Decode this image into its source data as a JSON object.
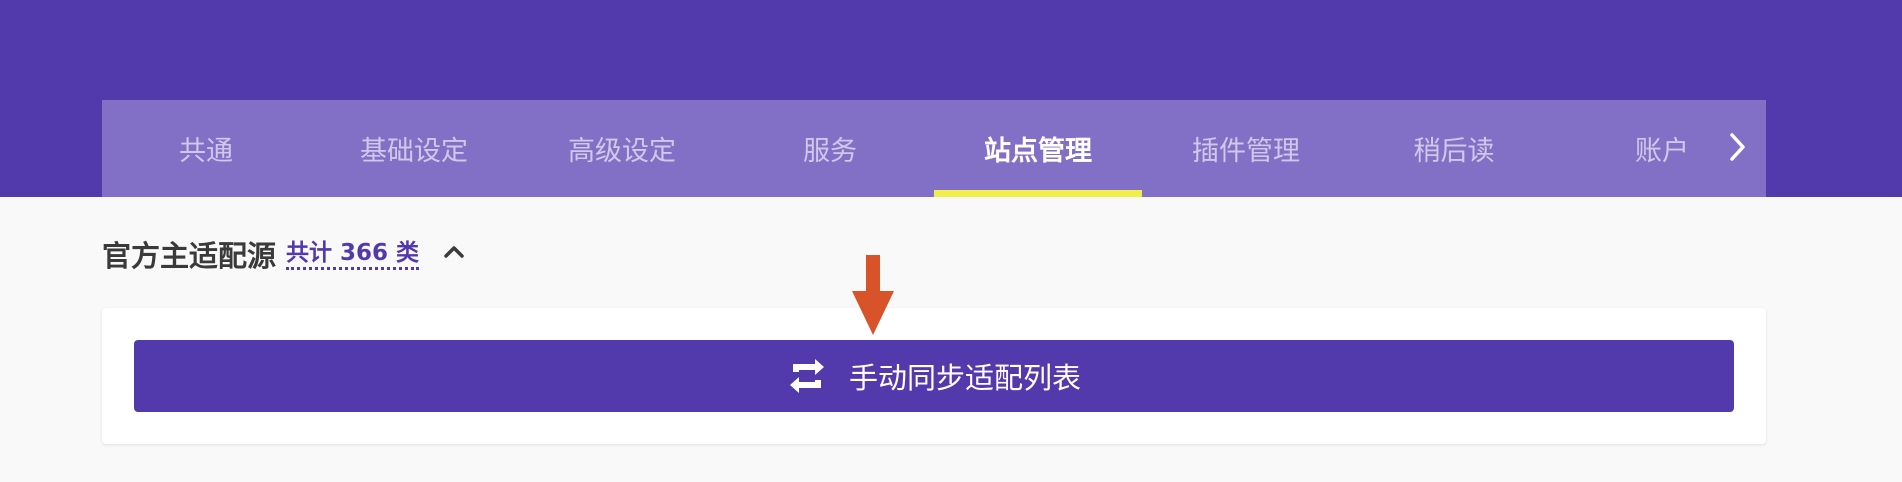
{
  "tabs": [
    {
      "label": "共通"
    },
    {
      "label": "基础设定"
    },
    {
      "label": "高级设定"
    },
    {
      "label": "服务"
    },
    {
      "label": "站点管理",
      "active": true
    },
    {
      "label": "插件管理"
    },
    {
      "label": "稍后读"
    },
    {
      "label": "账户"
    }
  ],
  "tab_next_icon": "chevron-right-icon",
  "section": {
    "title": "官方主适配源",
    "count_label": "共计 366 类",
    "collapse_icon": "chevron-up-icon"
  },
  "sync_button": {
    "label": "手动同步适配列表",
    "icon": "sync-icon"
  },
  "colors": {
    "primary": "#523aad",
    "tab_bar": "#8270c6",
    "active_indicator": "#f0ee4a",
    "annotation_arrow": "#d9532a"
  }
}
